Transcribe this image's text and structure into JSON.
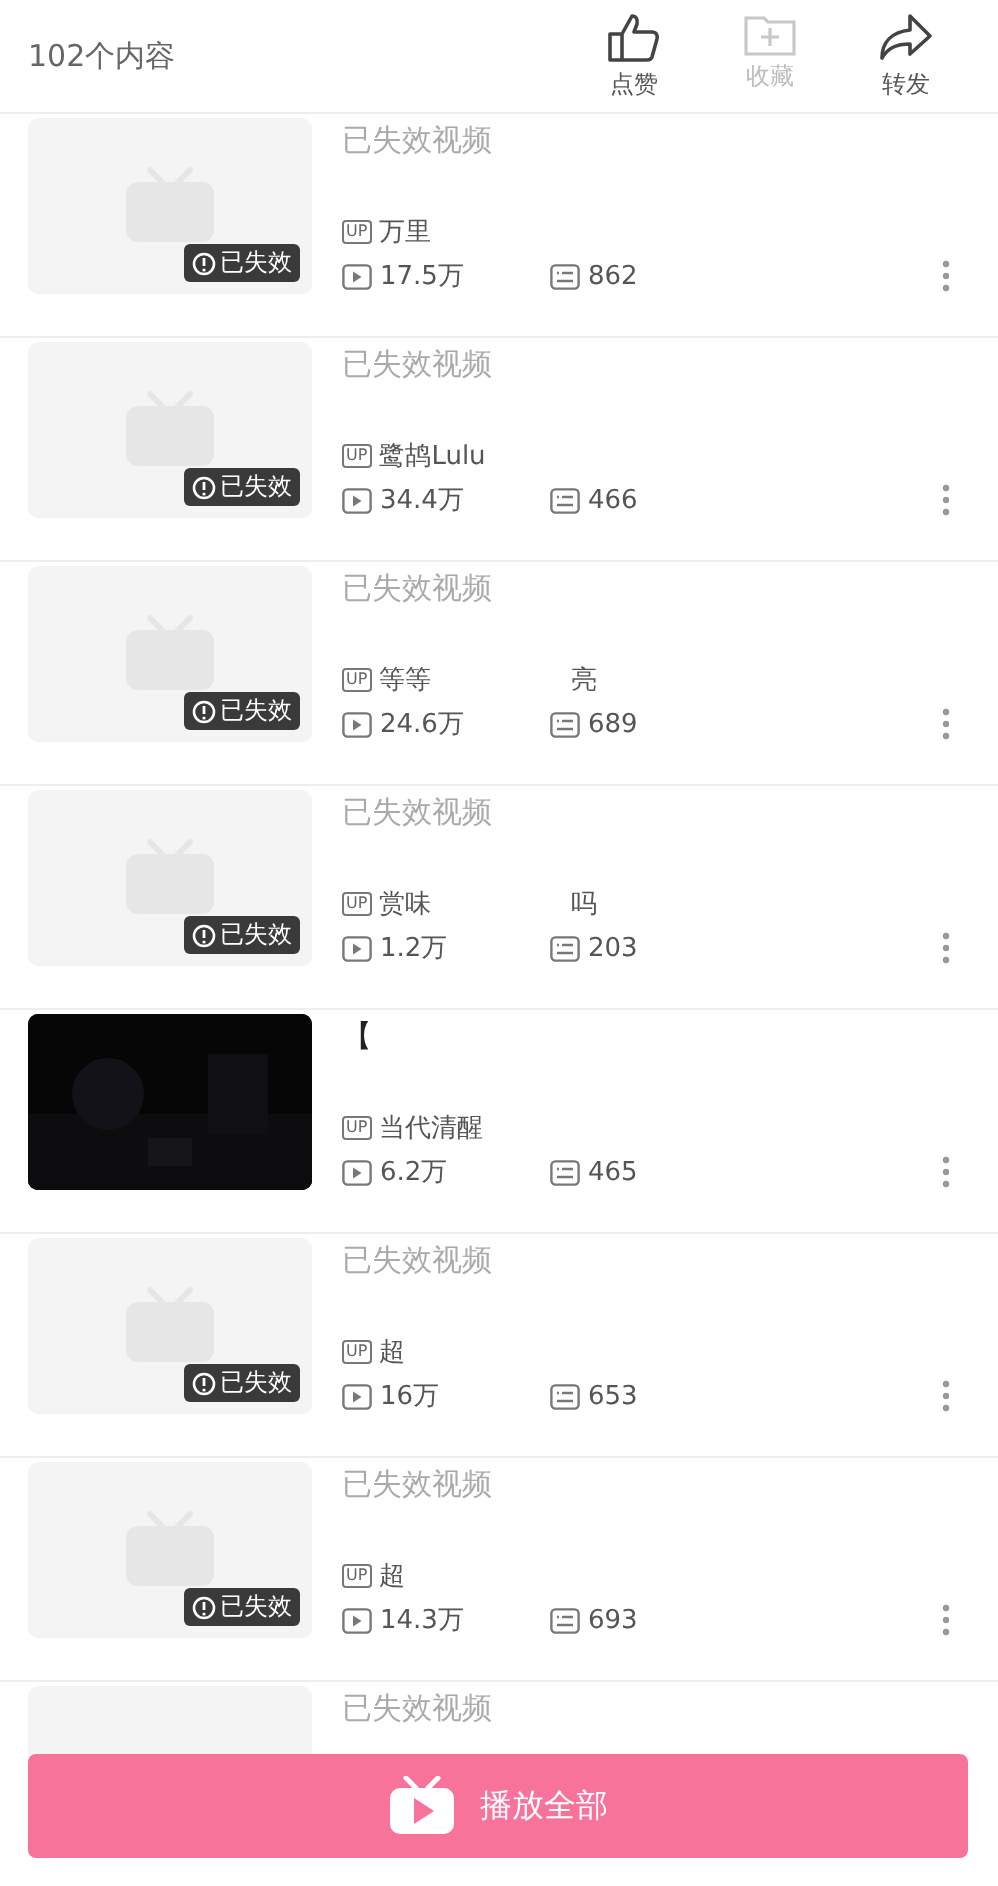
{
  "header": {
    "count": "102个内容",
    "actions": [
      {
        "label": "点赞",
        "kind": "like",
        "disabled": false
      },
      {
        "label": "收藏",
        "kind": "collect",
        "disabled": true
      },
      {
        "label": "转发",
        "kind": "share",
        "disabled": false
      }
    ]
  },
  "items": [
    {
      "kind": "invalid",
      "title": "已失效视频",
      "badge": "已失效",
      "up_label": "UP",
      "uploader": "万里",
      "views": "17.5万",
      "danmaku": "862"
    },
    {
      "kind": "invalid",
      "title": "已失效视频",
      "badge": "已失效",
      "up_label": "UP",
      "uploader": "鹭鸪Lulu",
      "views": "34.4万",
      "danmaku": "466"
    },
    {
      "kind": "invalid",
      "title": "已失效视频",
      "badge": "已失效",
      "up_label": "UP",
      "uploader": "等等",
      "uploader_end": "亮",
      "views": "24.6万",
      "danmaku": "689"
    },
    {
      "kind": "invalid",
      "title": "已失效视频",
      "badge": "已失效",
      "up_label": "UP",
      "uploader": "赏味",
      "uploader_end": "吗",
      "views": "1.2万",
      "danmaku": "203"
    },
    {
      "kind": "video",
      "title": "【",
      "up_label": "UP",
      "uploader": "当代清醒",
      "views": "6.2万",
      "danmaku": "465"
    },
    {
      "kind": "invalid",
      "title": "已失效视频",
      "badge": "已失效",
      "up_label": "UP",
      "uploader": "超",
      "views": "16万",
      "danmaku": "653"
    },
    {
      "kind": "invalid",
      "title": "已失效视频",
      "badge": "已失效",
      "up_label": "UP",
      "uploader": "超",
      "views": "14.3万",
      "danmaku": "693"
    },
    {
      "kind": "invalid",
      "title": "已失效视频"
    }
  ],
  "play_all": {
    "label": "播放全部"
  }
}
